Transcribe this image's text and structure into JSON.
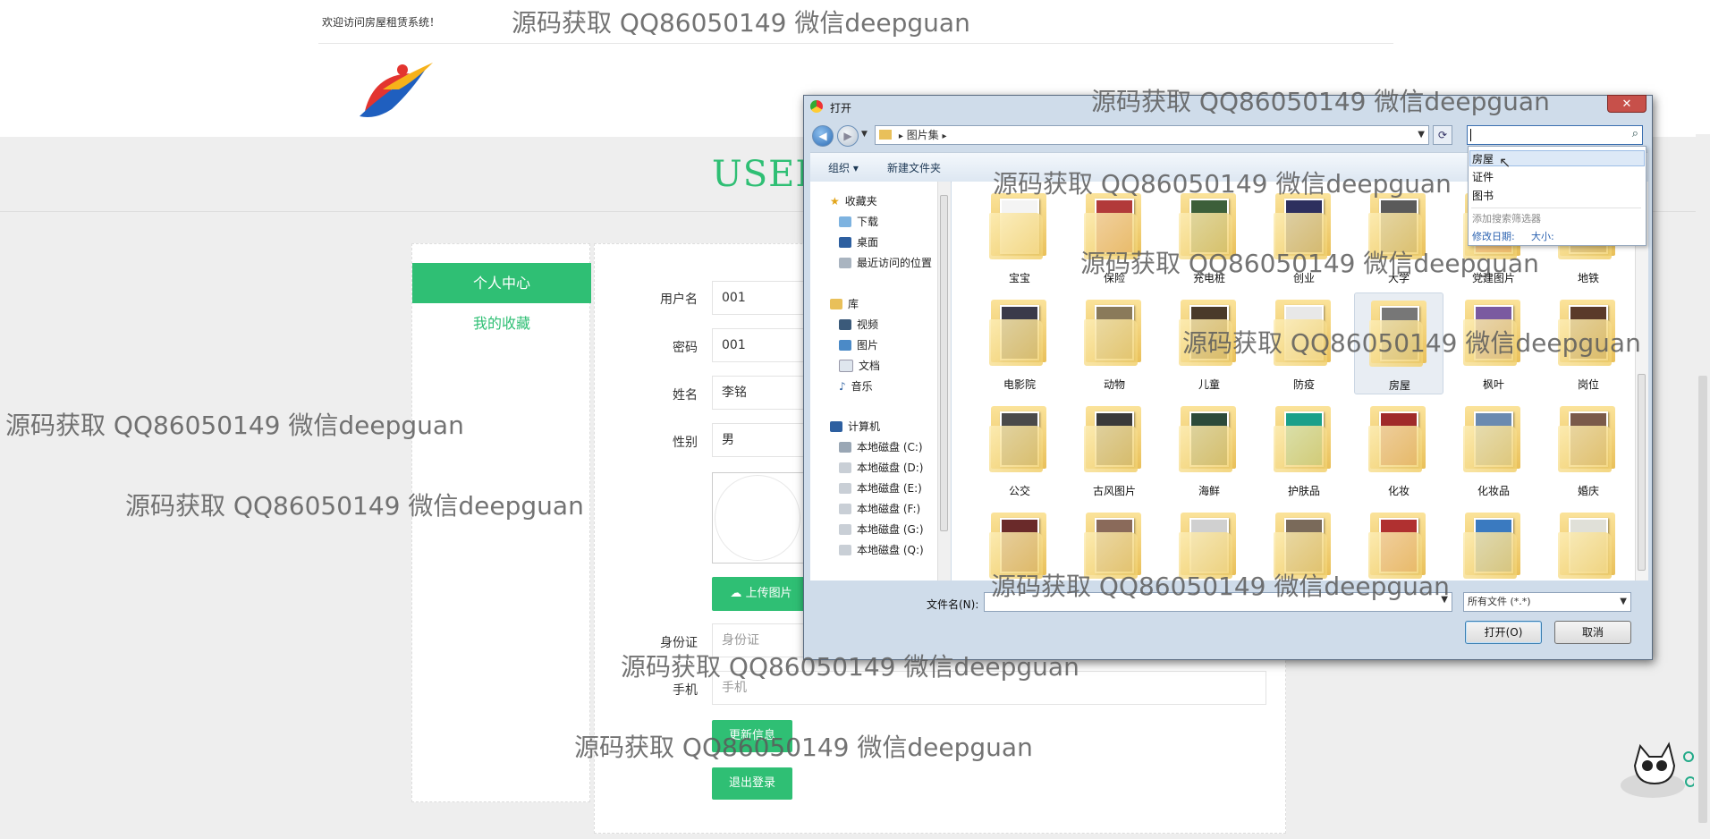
{
  "site": {
    "welcome": "欢迎访问房屋租赁系统！",
    "user_title": "USER",
    "menu": {
      "center": "个人中心",
      "favorites": "我的收藏"
    }
  },
  "form": {
    "username_label": "用户名",
    "username_value": "001",
    "password_label": "密码",
    "password_value": "001",
    "name_label": "姓名",
    "name_value": "李铭",
    "gender_label": "性别",
    "gender_value": "男",
    "upload_button": "上传图片",
    "idcard_label": "身份证",
    "idcard_placeholder": "身份证",
    "phone_label": "手机",
    "phone_placeholder": "手机",
    "update_button": "更新信息",
    "logout_button": "退出登录"
  },
  "dialog": {
    "title": "打开",
    "close": "✕",
    "breadcrumb": "图片集",
    "toolbar": {
      "organize": "组织 ▾",
      "new_folder": "新建文件夹"
    },
    "nav": {
      "favorites_header": "收藏夹",
      "favorites": [
        "下载",
        "桌面",
        "最近访问的位置"
      ],
      "library_header": "库",
      "library": [
        "视频",
        "图片",
        "文档",
        "音乐"
      ],
      "computer_header": "计算机",
      "drives": [
        "本地磁盘 (C:)",
        "本地磁盘 (D:)",
        "本地磁盘 (E:)",
        "本地磁盘 (F:)",
        "本地磁盘 (G:)",
        "本地磁盘 (Q:)"
      ]
    },
    "folders": [
      "宝宝",
      "保险",
      "充电桩",
      "创业",
      "大学",
      "党建图片",
      "地铁",
      "电影院",
      "动物",
      "儿童",
      "防疫",
      "房屋",
      "枫叶",
      "岗位",
      "公交",
      "古风图片",
      "海鲜",
      "护肤品",
      "化妆",
      "化妆品",
      "婚庆",
      "",
      "",
      "",
      "",
      "",
      "",
      ""
    ],
    "selected_folder": "房屋",
    "search_suggestions": [
      "房屋",
      "证件",
      "图书"
    ],
    "search_filter_label": "添加搜索筛选器",
    "search_filter_date": "修改日期:",
    "search_filter_size": "大小:",
    "filename_label": "文件名(N):",
    "filetype": "所有文件 (*.*)",
    "open_button": "打开(O)",
    "cancel_button": "取消"
  },
  "watermark": "源码获取 QQ86050149 微信deepguan",
  "colors": {
    "accent": "#2fbf74",
    "dialog_frame": "#cfdcea",
    "close_red": "#c7504a"
  }
}
